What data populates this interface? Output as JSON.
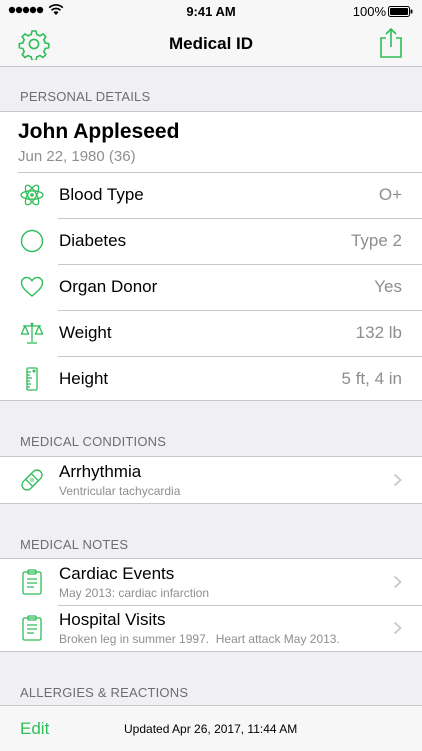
{
  "status_bar": {
    "time": "9:41 AM",
    "battery": "100%"
  },
  "nav": {
    "title": "Medical ID"
  },
  "personal": {
    "header": "PERSONAL DETAILS",
    "name": "John Appleseed",
    "dob": "Jun 22, 1980 (36)",
    "rows": [
      {
        "label": "Blood Type",
        "value": "O+"
      },
      {
        "label": "Diabetes",
        "value": "Type 2"
      },
      {
        "label": "Organ Donor",
        "value": "Yes"
      },
      {
        "label": "Weight",
        "value": "132 lb"
      },
      {
        "label": "Height",
        "value": "5 ft, 4 in"
      }
    ]
  },
  "conditions": {
    "header": "MEDICAL CONDITIONS",
    "items": [
      {
        "title": "Arrhythmia",
        "subtitle": "Ventricular tachycardia"
      }
    ]
  },
  "notes": {
    "header": "MEDICAL NOTES",
    "items": [
      {
        "title": "Cardiac Events",
        "subtitle": "May 2013: cardiac infarction"
      },
      {
        "title": "Hospital Visits",
        "subtitle": "Broken leg in summer 1997.  Heart attack May 2013."
      }
    ]
  },
  "allergies": {
    "header": "ALLERGIES & REACTIONS"
  },
  "toolbar": {
    "edit": "Edit",
    "updated": "Updated Apr 26, 2017, 11:44 AM"
  },
  "colors": {
    "accent": "#2ebd59",
    "secondary_text": "#8e8e93",
    "background": "#efeff4"
  }
}
